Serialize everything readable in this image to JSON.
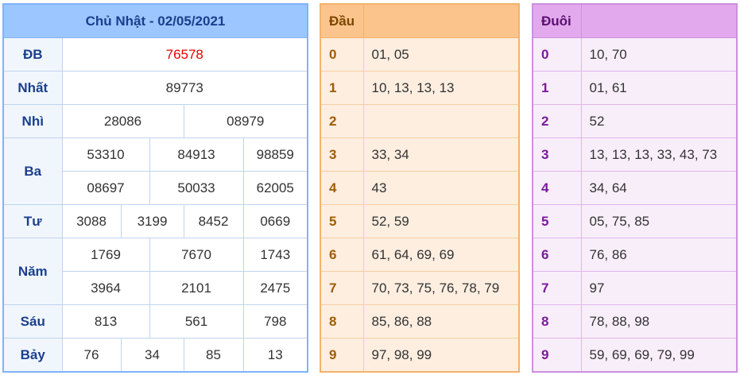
{
  "results": {
    "title": "Chủ Nhật - 02/05/2021",
    "labels": {
      "db": "ĐB",
      "nhat": "Nhất",
      "nhi": "Nhì",
      "ba": "Ba",
      "tu": "Tư",
      "nam": "Năm",
      "sau": "Sáu",
      "bay": "Bảy"
    },
    "db": "76578",
    "nhat": "89773",
    "nhi": [
      "28086",
      "08979"
    ],
    "ba": [
      "53310",
      "84913",
      "98859",
      "08697",
      "50033",
      "62005"
    ],
    "tu": [
      "3088",
      "3199",
      "8452",
      "0669"
    ],
    "nam": [
      "1769",
      "7670",
      "1743",
      "3964",
      "2101",
      "2475"
    ],
    "sau": [
      "813",
      "561",
      "798"
    ],
    "bay": [
      "76",
      "34",
      "85",
      "13"
    ]
  },
  "dau": {
    "header": "Đầu",
    "rows": [
      {
        "key": "0",
        "value": "01, 05"
      },
      {
        "key": "1",
        "value": "10, 13, 13, 13"
      },
      {
        "key": "2",
        "value": ""
      },
      {
        "key": "3",
        "value": "33, 34"
      },
      {
        "key": "4",
        "value": "43"
      },
      {
        "key": "5",
        "value": "52, 59"
      },
      {
        "key": "6",
        "value": "61, 64, 69, 69"
      },
      {
        "key": "7",
        "value": "70, 73, 75, 76, 78, 79"
      },
      {
        "key": "8",
        "value": "85, 86, 88"
      },
      {
        "key": "9",
        "value": "97, 98, 99"
      }
    ]
  },
  "duoi": {
    "header": "Đuôi",
    "rows": [
      {
        "key": "0",
        "value": "10, 70"
      },
      {
        "key": "1",
        "value": "01, 61"
      },
      {
        "key": "2",
        "value": "52"
      },
      {
        "key": "3",
        "value": "13, 13, 13, 33, 43, 73"
      },
      {
        "key": "4",
        "value": "34, 64"
      },
      {
        "key": "5",
        "value": "05, 75, 85"
      },
      {
        "key": "6",
        "value": "76, 86"
      },
      {
        "key": "7",
        "value": "97"
      },
      {
        "key": "8",
        "value": "78, 88, 98"
      },
      {
        "key": "9",
        "value": "59, 69, 69, 79, 99"
      }
    ]
  }
}
